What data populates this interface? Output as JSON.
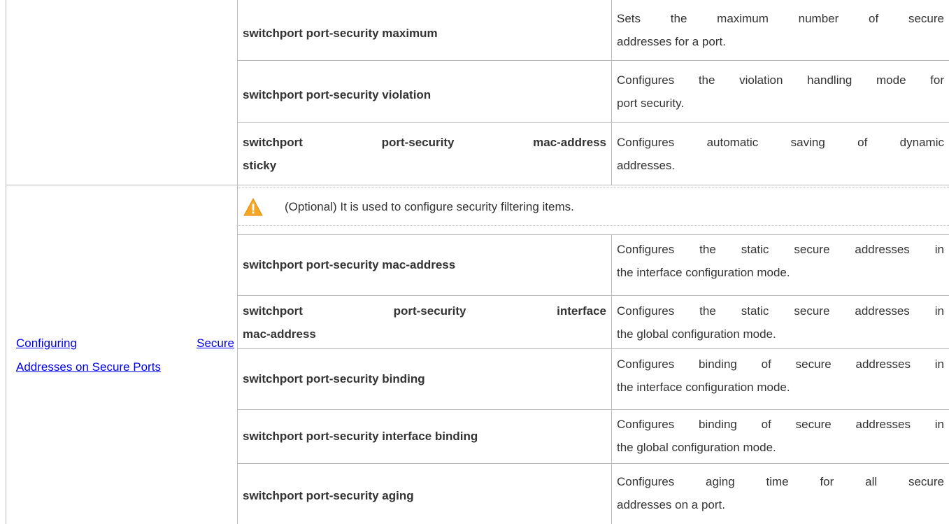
{
  "section_link": {
    "word1": "Configuring",
    "word2": "Secure",
    "line2": "Addresses on Secure Ports"
  },
  "optional_note": "(Optional) It is used to configure security filtering items.",
  "upper_rows": [
    {
      "command": "switchport port-security maximum",
      "desc1": "Sets the maximum number of secure",
      "desc2": "addresses for a port."
    },
    {
      "command": "switchport port-security violation",
      "desc1": "Configures the violation handling mode for",
      "desc2": "port security."
    },
    {
      "command1": "switchport port-security mac-address",
      "command2": "sticky",
      "desc1": "Configures automatic saving of dynamic",
      "desc2": "addresses."
    }
  ],
  "lower_rows": [
    {
      "command": "switchport port-security mac-address",
      "desc1": "Configures the static secure addresses in",
      "desc2": "the interface configuration mode."
    },
    {
      "command1": "switchport port-security interface",
      "command2": "mac-address",
      "desc1": "Configures the static secure addresses in",
      "desc2": "the global configuration mode."
    },
    {
      "command": "switchport port-security binding",
      "desc1": "Configures binding of secure addresses in",
      "desc2": "the interface configuration mode."
    },
    {
      "command": "switchport port-security interface binding",
      "desc1": "Configures binding of secure addresses in",
      "desc2": "the global configuration mode."
    },
    {
      "command": "switchport port-security aging",
      "desc1": "Configures aging time for all secure",
      "desc2": "addresses on a port."
    }
  ],
  "colors": {
    "link": "#0000ee",
    "border": "#b9b9b9",
    "text": "#333333",
    "warning": "#f5a623"
  },
  "icons": {
    "warning": "warning-triangle-icon"
  }
}
